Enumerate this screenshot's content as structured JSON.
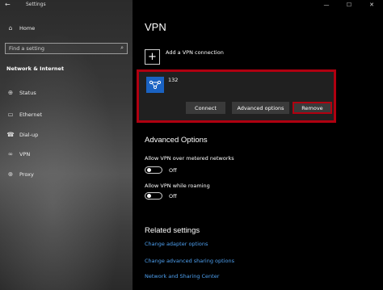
{
  "window": {
    "app_title": "Settings",
    "controls": {
      "minimize": "—",
      "maximize": "☐",
      "close": "✕"
    }
  },
  "sidebar": {
    "home_label": "Home",
    "search_placeholder": "Find a setting",
    "section_title": "Network & Internet",
    "items": [
      {
        "label": "Status",
        "icon": "globe-icon"
      },
      {
        "label": "Ethernet",
        "icon": "ethernet-icon"
      },
      {
        "label": "Dial-up",
        "icon": "phone-icon"
      },
      {
        "label": "VPN",
        "icon": "vpn-icon"
      },
      {
        "label": "Proxy",
        "icon": "globe-icon"
      }
    ]
  },
  "main": {
    "title": "VPN",
    "add_connection_label": "Add a VPN connection",
    "vpn_entry": {
      "name": "132",
      "buttons": {
        "connect": "Connect",
        "advanced": "Advanced options",
        "remove": "Remove"
      }
    },
    "advanced": {
      "heading": "Advanced Options",
      "metered": {
        "label": "Allow VPN over metered networks",
        "state": "Off"
      },
      "roaming": {
        "label": "Allow VPN while roaming",
        "state": "Off"
      }
    },
    "related": {
      "heading": "Related settings",
      "links": [
        "Change adapter options",
        "Change advanced sharing options",
        "Network and Sharing Center"
      ]
    }
  },
  "colors": {
    "highlight_red": "#b00010",
    "link_blue": "#4ea0f0",
    "vpn_icon_blue": "#1a62c2"
  }
}
